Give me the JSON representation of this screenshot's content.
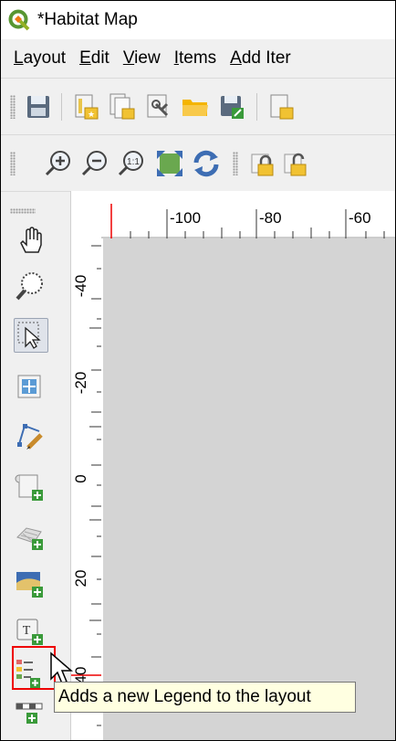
{
  "window": {
    "title": "*Habitat Map"
  },
  "menu": {
    "items": [
      {
        "pre": "",
        "acc": "L",
        "post": "ayout"
      },
      {
        "pre": "",
        "acc": "E",
        "post": "dit"
      },
      {
        "pre": "",
        "acc": "V",
        "post": "iew"
      },
      {
        "pre": "",
        "acc": "I",
        "post": "tems"
      },
      {
        "pre": "",
        "acc": "A",
        "post": "dd Iter"
      }
    ]
  },
  "toolbar1": {
    "icons": [
      "save-icon",
      "new-layout-icon",
      "duplicate-layout-icon",
      "layout-manager-icon",
      "open-folder-icon",
      "save-as-template-icon",
      "new-page-icon"
    ]
  },
  "toolbar2": {
    "icons": [
      "zoom-in-icon",
      "zoom-out-icon",
      "zoom-actual-icon",
      "zoom-full-icon",
      "refresh-icon",
      "lock-icon",
      "unlock-icon"
    ]
  },
  "left_tools": {
    "icons": [
      "pan-icon",
      "zoom-tool-icon",
      "select-move-icon",
      "move-content-icon",
      "edit-nodes-icon",
      "add-map-icon",
      "add-3d-map-icon",
      "add-picture-icon",
      "add-label-icon",
      "add-legend-icon",
      "add-scalebar-icon"
    ]
  },
  "rulers": {
    "horizontal_labels": [
      "-100",
      "-80",
      "-60"
    ],
    "vertical_labels": [
      "-40",
      "-20",
      "0",
      "20",
      "40"
    ]
  },
  "tooltip": {
    "text": "Adds a new Legend to the layout"
  },
  "colors": {
    "highlight": "#e00000",
    "tooltip_bg": "#ffffe1",
    "canvas": "#d4d4d4",
    "panel": "#f0f0f0"
  }
}
